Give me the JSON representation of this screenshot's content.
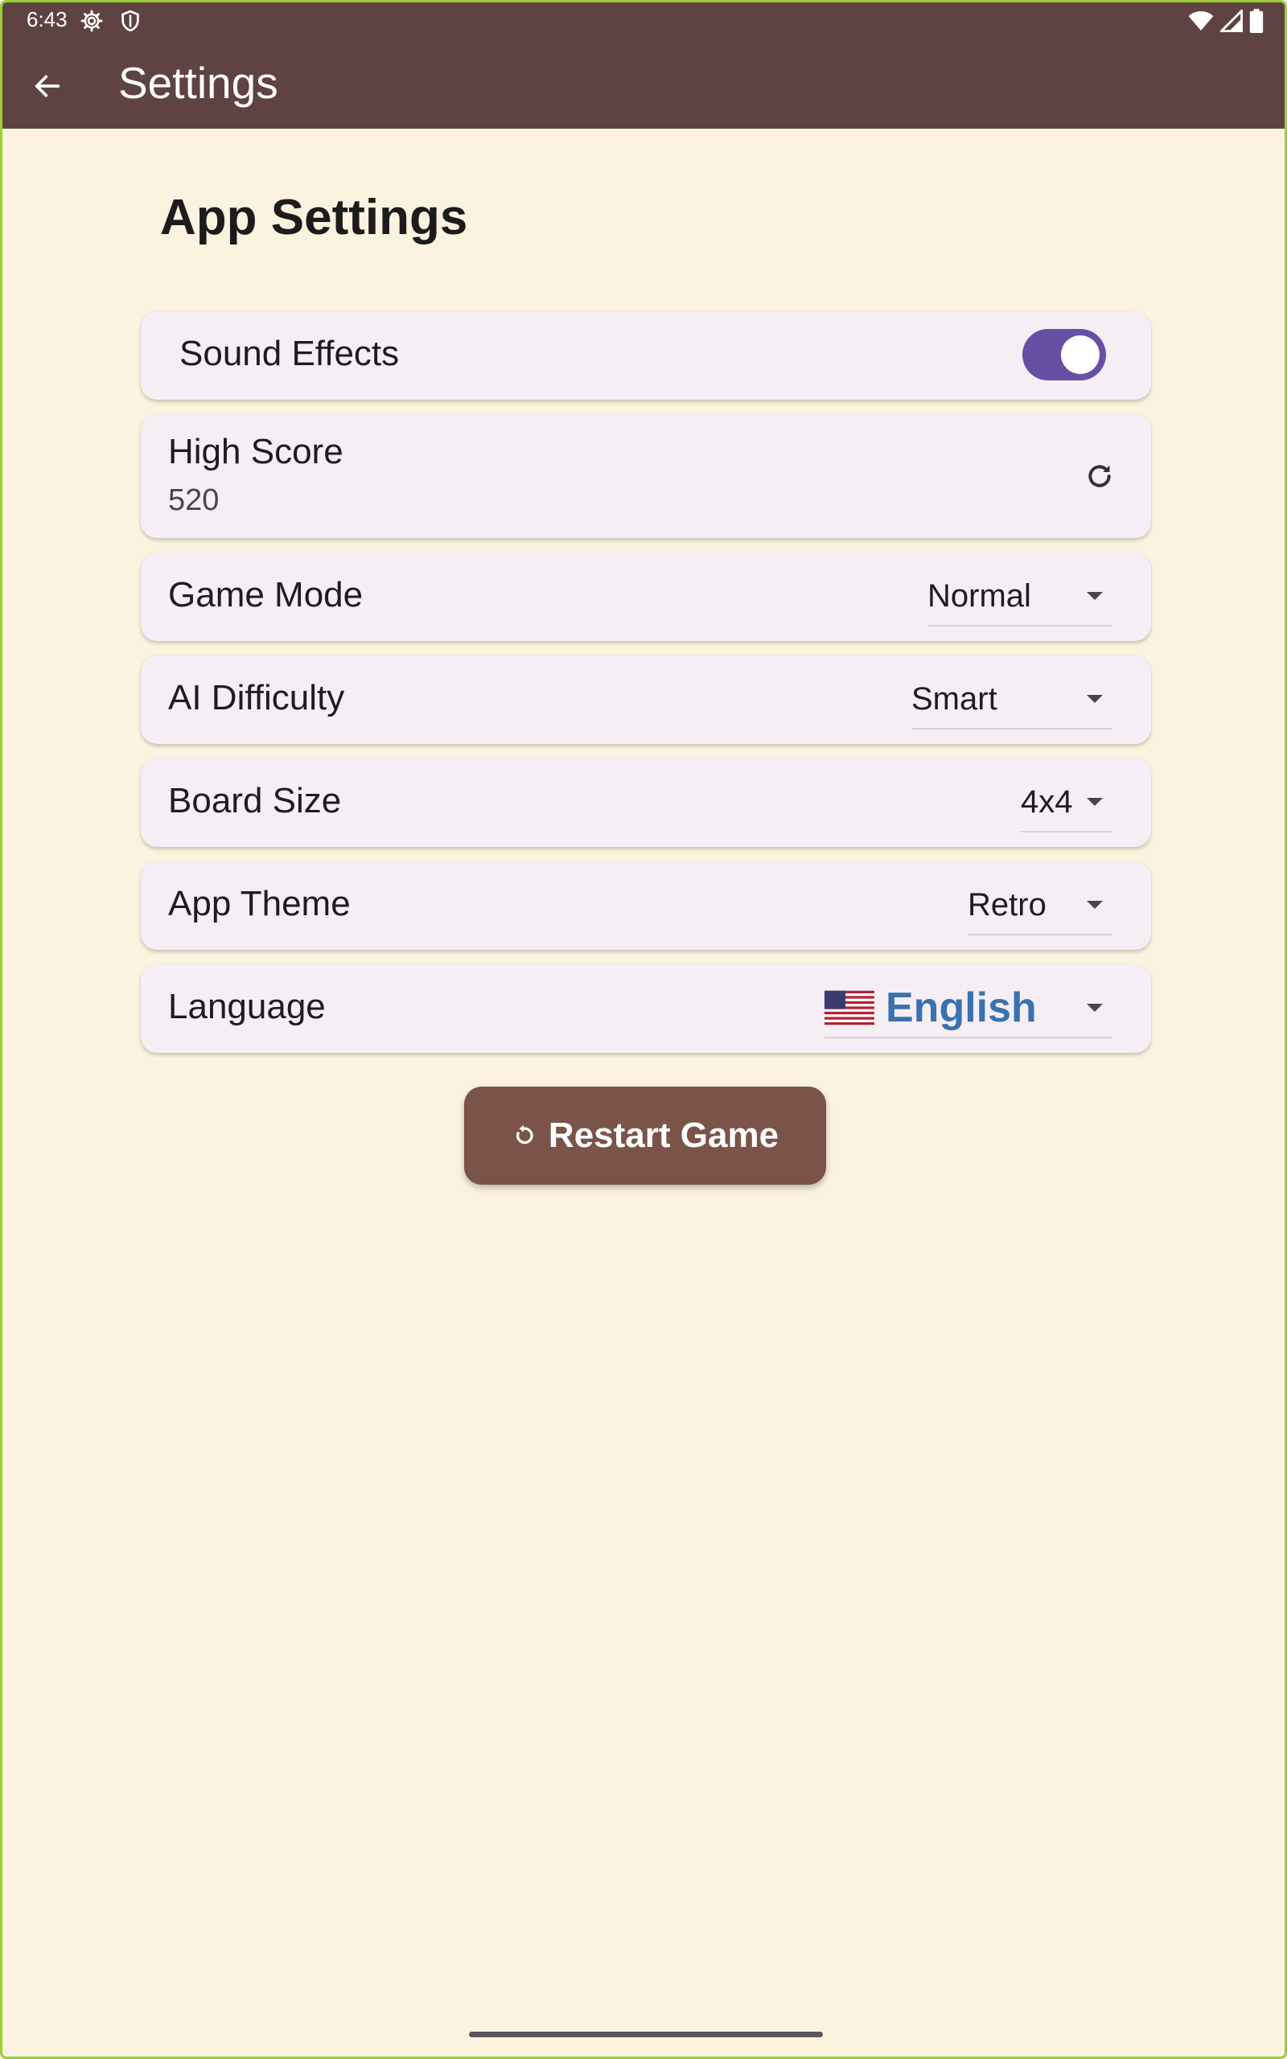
{
  "status_bar": {
    "time": "6:43",
    "icons": [
      "gear-icon",
      "shield-icon",
      "wifi-icon",
      "signal-icon",
      "battery-icon"
    ]
  },
  "app_bar": {
    "title": "Settings",
    "back_icon": "arrow-back-icon"
  },
  "page": {
    "heading": "App Settings"
  },
  "settings": {
    "sound_effects": {
      "label": "Sound Effects",
      "enabled": true
    },
    "high_score": {
      "label": "High Score",
      "value": "520",
      "reset_icon": "refresh-icon"
    },
    "game_mode": {
      "label": "Game Mode",
      "value": "Normal"
    },
    "ai_difficulty": {
      "label": "AI Difficulty",
      "value": "Smart"
    },
    "board_size": {
      "label": "Board Size",
      "value": "4x4"
    },
    "app_theme": {
      "label": "App Theme",
      "value": "Retro"
    },
    "language": {
      "label": "Language",
      "flag": "🇺🇸",
      "value": "English"
    }
  },
  "restart_button": {
    "label": "Restart Game",
    "icon": "restart-icon"
  },
  "colors": {
    "app_bar": "#5f4342",
    "background": "#fbf3df",
    "card": "#f5eff5",
    "switch_track": "#6750a4",
    "restart_button": "#7a5448",
    "language_text": "#3a72b0"
  }
}
